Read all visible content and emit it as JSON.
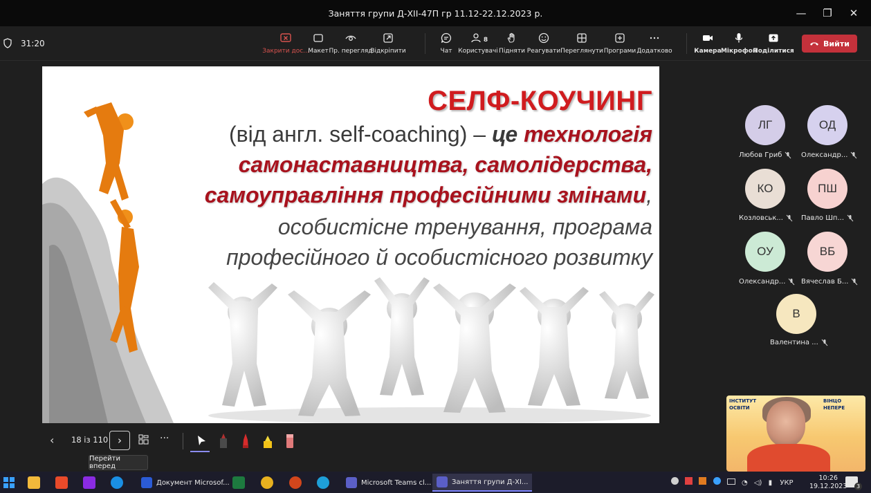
{
  "window": {
    "title": "Заняття групи Д-ХІІ-47П гр 11.12-22.12.2023 р.",
    "minimize": "—",
    "maximize": "❐",
    "close": "✕"
  },
  "meeting": {
    "timer": "31:20",
    "leave_label": "Вийти",
    "participant_count": "8",
    "buttons": [
      {
        "name": "stop-sharing",
        "label": "Закрити дос...",
        "icon": "stop-share-icon"
      },
      {
        "name": "layout",
        "label": "Макет",
        "icon": "layout-icon"
      },
      {
        "name": "private-view",
        "label": "Пр. перегляд",
        "icon": "eye-icon"
      },
      {
        "name": "unpin",
        "label": "Відкріпити",
        "icon": "popout-icon"
      },
      {
        "name": "chat",
        "label": "Чат",
        "icon": "chat-icon"
      },
      {
        "name": "people",
        "label": "Користувачі",
        "icon": "people-icon"
      },
      {
        "name": "raise-hand",
        "label": "Підняти",
        "icon": "hand-icon"
      },
      {
        "name": "react",
        "label": "Реагувати",
        "icon": "smile-icon"
      },
      {
        "name": "view",
        "label": "Переглянути",
        "icon": "grid-icon"
      },
      {
        "name": "apps",
        "label": "Програми",
        "icon": "apps-icon"
      },
      {
        "name": "more",
        "label": "Додатково",
        "icon": "more-icon"
      },
      {
        "name": "camera",
        "label": "Камера",
        "icon": "camera-icon"
      },
      {
        "name": "mic",
        "label": "Мікрофон",
        "icon": "mic-icon"
      },
      {
        "name": "share",
        "label": "Поділитися",
        "icon": "share-icon"
      }
    ]
  },
  "slide": {
    "heading": "СЕЛФ-КОУЧИНГ",
    "line1_plain": "(від англ. self-coaching) – ",
    "line1_em1": "це",
    "line1_em2": "технологія",
    "line2": "самонаставництва, самолідерства,",
    "line3_em": "самоуправління професійними змінами",
    "line3_tail": ",",
    "line4": "особистісне тренування, програма",
    "line5": "професійного й особистісного розвитку"
  },
  "participants": [
    {
      "initials": "ЛГ",
      "name": "Любов Гриб",
      "color": "#d4cde8"
    },
    {
      "initials": "ОД",
      "name": "Олександр...",
      "color": "#d6d1ee"
    },
    {
      "initials": "КО",
      "name": "Козловськ...",
      "color": "#e9ded5"
    },
    {
      "initials": "ПШ",
      "name": "Павло Шп...",
      "color": "#f7d2d0"
    },
    {
      "initials": "ОУ",
      "name": "Олександр...",
      "color": "#ccead5"
    },
    {
      "initials": "ВБ",
      "name": "Вячеслав Б...",
      "color": "#f7d6d4"
    },
    {
      "initials": "В",
      "name": "Валентина ...",
      "color": "#f6e7bf"
    }
  ],
  "slide_nav": {
    "page": "18 із 110",
    "next_tooltip": "Перейти вперед",
    "prev": "‹",
    "next": "›",
    "more": "···"
  },
  "self_video": {
    "banner1": "ВІНЦО",
    "banner2": "ІНСТИТУТ",
    "banner3": "НЕПЕРЕ",
    "banner4": "ОСВІТИ"
  },
  "taskbar": {
    "windows": [
      {
        "label": "Документ Microsof...",
        "color": "#2b5bd6"
      },
      {
        "label": "Microsoft Teams cl...",
        "color": "#5b5fc7"
      },
      {
        "label": "Заняття групи Д-ХІ...",
        "color": "#5b5fc7"
      }
    ],
    "language": "УКР",
    "time": "10:26",
    "date": "19.12.2023",
    "notifications": "3"
  }
}
